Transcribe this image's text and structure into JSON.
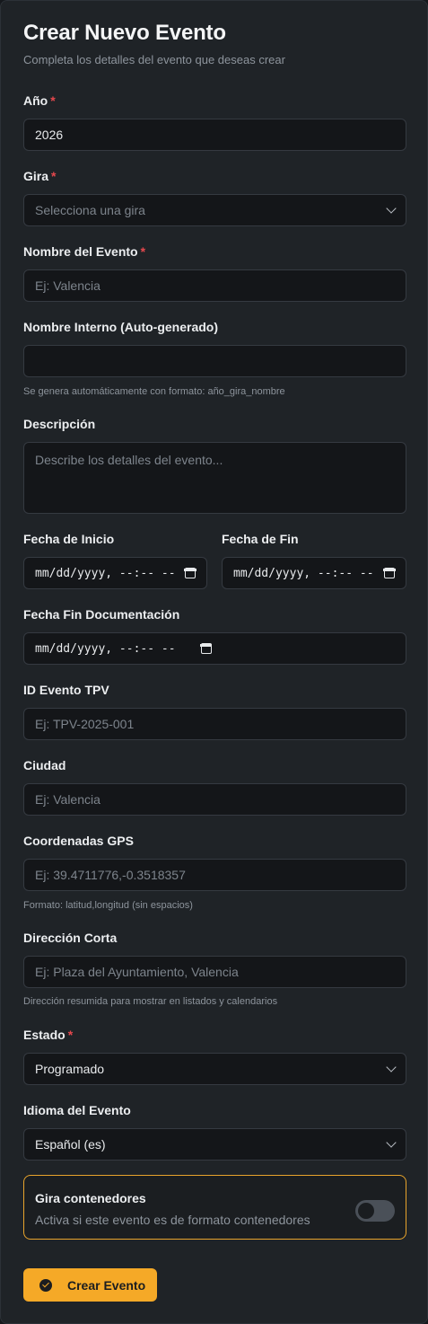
{
  "form": {
    "title": "Crear Nuevo Evento",
    "subtitle": "Completa los detalles del evento que deseas crear",
    "year": {
      "label": "Año",
      "value": "2026"
    },
    "tour": {
      "label": "Gira",
      "selected": "Selecciona una gira"
    },
    "event_name": {
      "label": "Nombre del Evento",
      "placeholder": "Ej: Valencia"
    },
    "internal_name": {
      "label": "Nombre Interno (Auto-generado)",
      "value": "",
      "help": "Se genera automáticamente con formato: año_gira_nombre"
    },
    "description": {
      "label": "Descripción",
      "placeholder": "Describe los detalles del evento..."
    },
    "start_date": {
      "label": "Fecha de Inicio",
      "value": "mm/dd/yyyy, --:-- --"
    },
    "end_date": {
      "label": "Fecha de Fin",
      "value": "mm/dd/yyyy, --:-- --"
    },
    "doc_end_date": {
      "label": "Fecha Fin Documentación",
      "value": "mm/dd/yyyy, --:-- --"
    },
    "tpv_id": {
      "label": "ID Evento TPV",
      "placeholder": "Ej: TPV-2025-001"
    },
    "city": {
      "label": "Ciudad",
      "placeholder": "Ej: Valencia"
    },
    "gps": {
      "label": "Coordenadas GPS",
      "placeholder": "Ej: 39.4711776,-0.3518357",
      "help": "Formato: latitud,longitud (sin espacios)"
    },
    "short_address": {
      "label": "Dirección Corta",
      "placeholder": "Ej: Plaza del Ayuntamiento, Valencia",
      "help": "Dirección resumida para mostrar en listados y calendarios"
    },
    "status": {
      "label": "Estado",
      "selected": "Programado"
    },
    "language": {
      "label": "Idioma del Evento",
      "selected": "Español (es)"
    },
    "container_tour": {
      "title": "Gira contenedores",
      "description": "Activa si este evento es de formato contenedores",
      "enabled": false
    },
    "required_mark": "*",
    "submit_label": "Crear Evento"
  },
  "colors": {
    "accent": "#f5a927",
    "required": "#e5484d",
    "background": "#1f2327",
    "field": "#141619"
  },
  "icons": {
    "select": "chevron-down-icon",
    "date": "calendar-icon",
    "submit": "check-circle-icon"
  }
}
